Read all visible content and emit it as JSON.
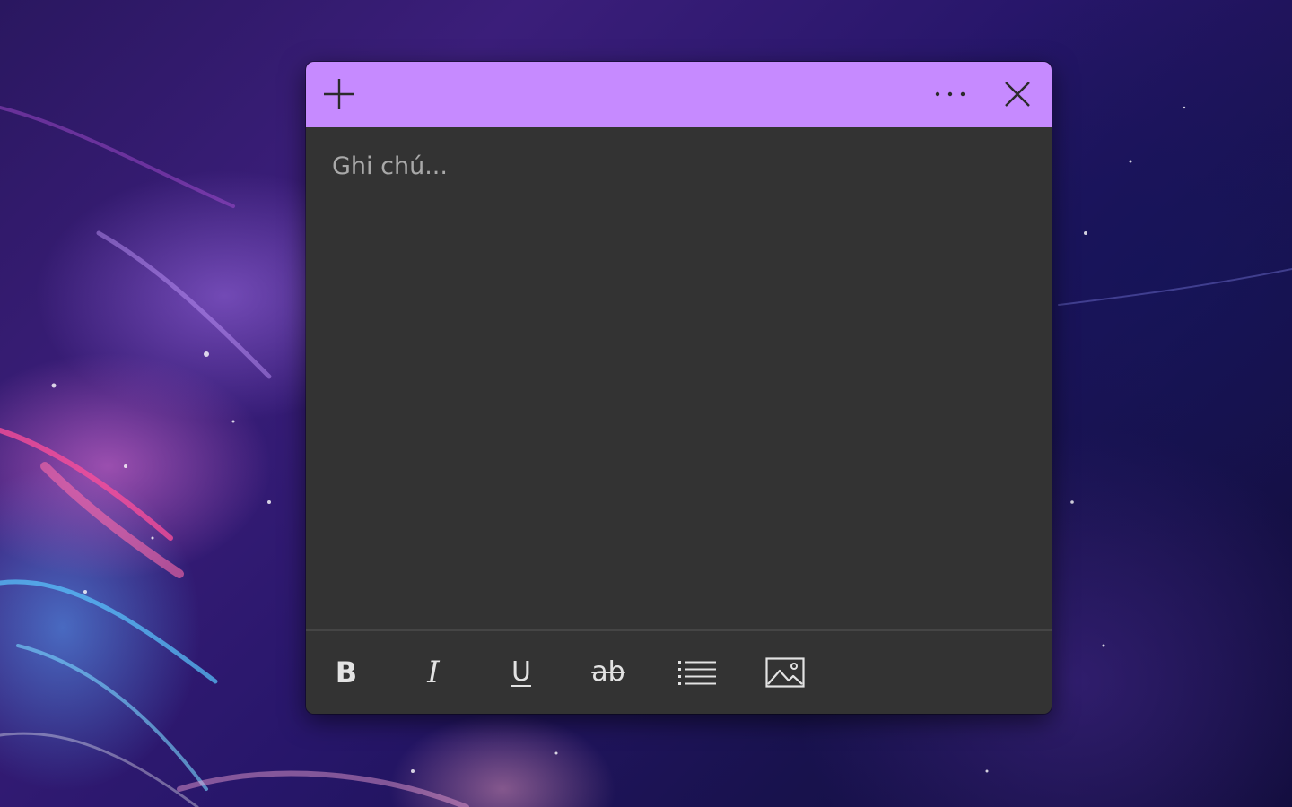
{
  "note": {
    "placeholder": "Ghi chú...",
    "value": "",
    "accent_color": "#c68aff",
    "body_color": "#333333"
  },
  "title_bar": {
    "buttons": [
      {
        "name": "new-note-button",
        "icon": "plus-icon"
      },
      {
        "name": "menu-button",
        "icon": "more-horizontal-icon"
      },
      {
        "name": "close-button",
        "icon": "close-icon"
      }
    ]
  },
  "toolbar": {
    "bold_glyph": "B",
    "italic_glyph": "I",
    "underline_glyph": "U",
    "strikethrough_glyph": "ab",
    "buttons": [
      {
        "name": "bold-button",
        "icon": "bold-icon"
      },
      {
        "name": "italic-button",
        "icon": "italic-icon"
      },
      {
        "name": "underline-button",
        "icon": "underline-icon"
      },
      {
        "name": "strikethrough-button",
        "icon": "strikethrough-icon"
      },
      {
        "name": "bullet-list-button",
        "icon": "bullet-list-icon"
      },
      {
        "name": "add-image-button",
        "icon": "image-icon"
      }
    ]
  }
}
